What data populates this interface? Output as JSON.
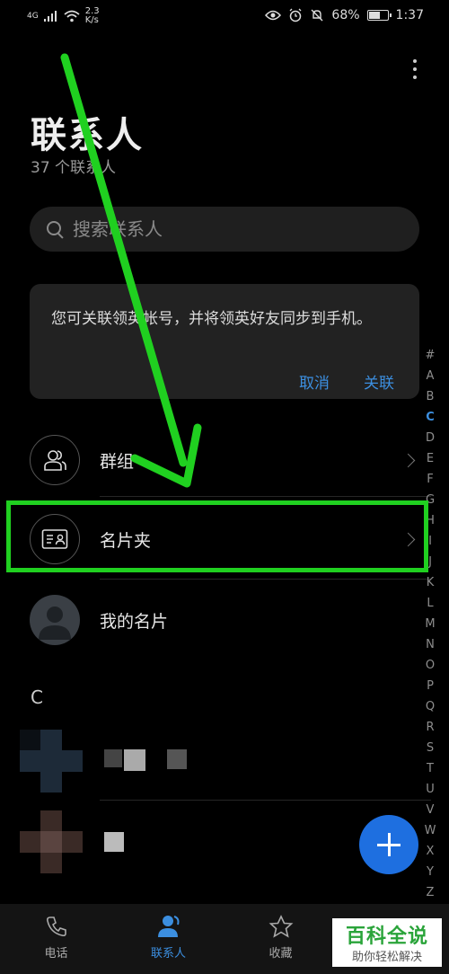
{
  "status_bar": {
    "signal": "4G",
    "speed": "2.3",
    "speed_unit": "K/s",
    "battery": "68%",
    "battery_level": 0.68,
    "time": "1:37"
  },
  "header": {
    "title": "联系人",
    "subtitle": "37 个联系人"
  },
  "search": {
    "placeholder": "搜索联系人"
  },
  "notice": {
    "text": "您可关联领英帐号，并将领英好友同步到手机。",
    "cancel_label": "取消",
    "link_label": "关联"
  },
  "rows": {
    "groups": "群组",
    "cards": "名片夹",
    "my_card": "我的名片"
  },
  "section_letter": "C",
  "alpha_index": [
    "#",
    "A",
    "B",
    "C",
    "D",
    "E",
    "F",
    "G",
    "H",
    "I",
    "J",
    "K",
    "L",
    "M",
    "N",
    "O",
    "P",
    "Q",
    "R",
    "S",
    "T",
    "U",
    "V",
    "W",
    "X",
    "Y",
    "Z"
  ],
  "alpha_active": "C",
  "bottom_nav": {
    "phone": "电话",
    "contacts": "联系人",
    "favorites": "收藏"
  },
  "watermark": {
    "top": "百科全说",
    "bottom": "助你轻松解决"
  },
  "colors": {
    "accent": "#3c8fe0",
    "fab": "#1e6fe0",
    "annotation": "#20d020"
  }
}
